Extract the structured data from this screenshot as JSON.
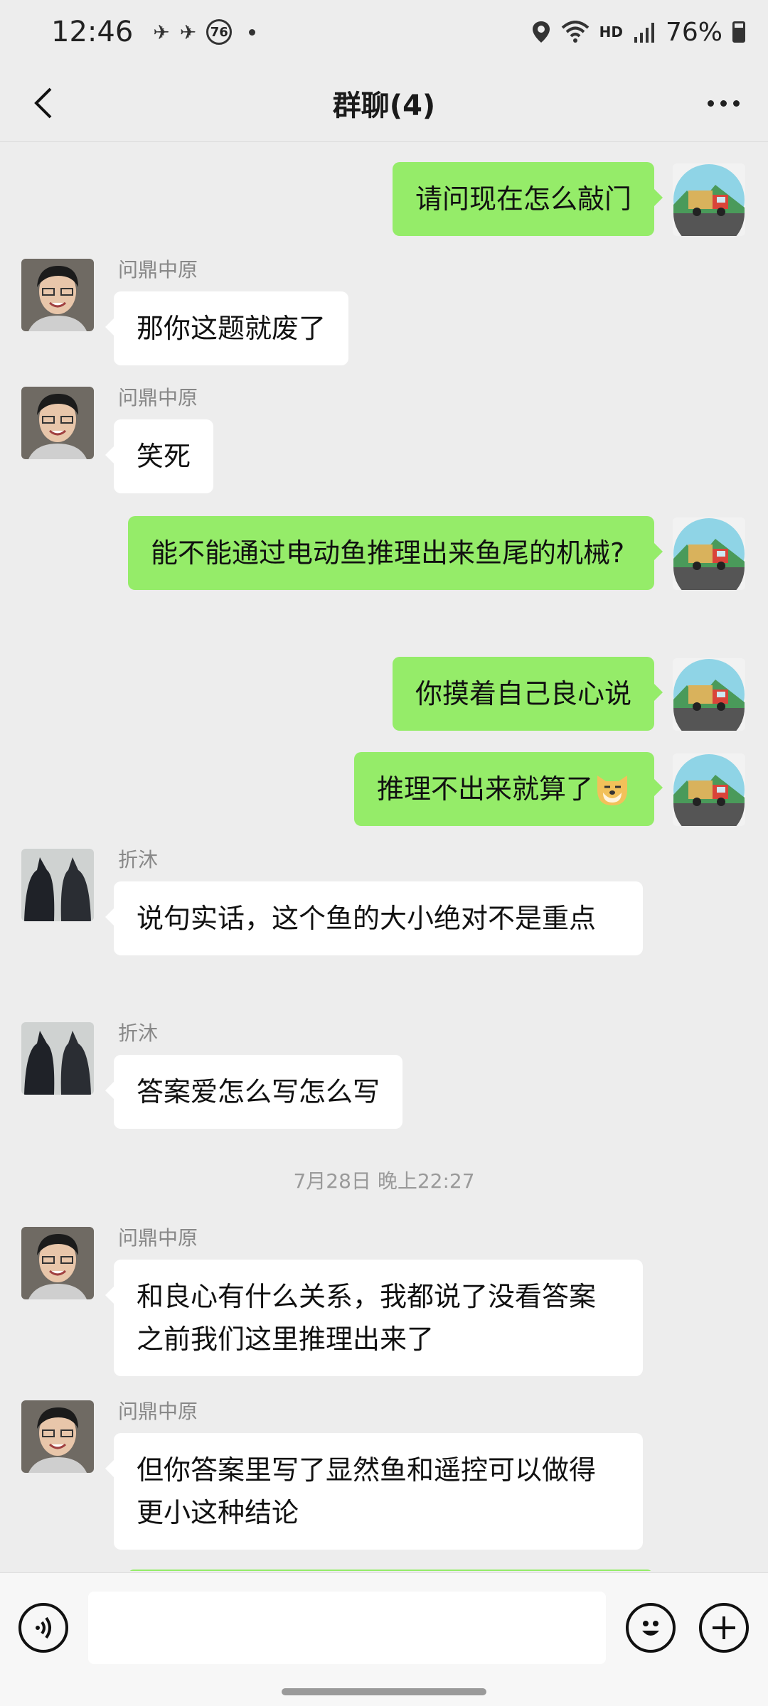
{
  "status_bar": {
    "time": "12:46",
    "notification_badge": "76",
    "network": "HD",
    "battery": "76%"
  },
  "header": {
    "title": "群聊(4)",
    "back_icon": "chevron-left-icon",
    "more_icon": "more-dots-icon"
  },
  "messages": [
    {
      "side": "me",
      "text": "请问现在怎么敲门"
    },
    {
      "side": "other",
      "sender": "问鼎中原",
      "text": "那你这题就废了"
    },
    {
      "side": "other",
      "sender": "问鼎中原",
      "text": "笑死"
    },
    {
      "side": "me",
      "text": "能不能通过电动鱼推理出来鱼尾的机械?"
    },
    {
      "side": "me",
      "text": "你摸着自己良心说"
    },
    {
      "side": "me",
      "text": "推理不出来就算了",
      "emoji": "doge-emoji"
    },
    {
      "side": "other",
      "sender": "折沐",
      "text": "说句实话，这个鱼的大小绝对不是重点"
    },
    {
      "side": "other",
      "sender": "折沐",
      "text": "答案爱怎么写怎么写"
    },
    {
      "side": "other",
      "sender": "问鼎中原",
      "text": "和良心有什么关系，我都说了没看答案之前我们这里推理出来了"
    },
    {
      "side": "other",
      "sender": "问鼎中原",
      "text": "但你答案里写了显然鱼和遥控可以做得更小这种结论"
    }
  ],
  "timestamp": "7月28日 晚上22:27",
  "input_bar": {
    "voice_icon": "voice-icon",
    "emoji_icon": "emoji-icon",
    "plus_icon": "plus-icon",
    "input_value": ""
  }
}
